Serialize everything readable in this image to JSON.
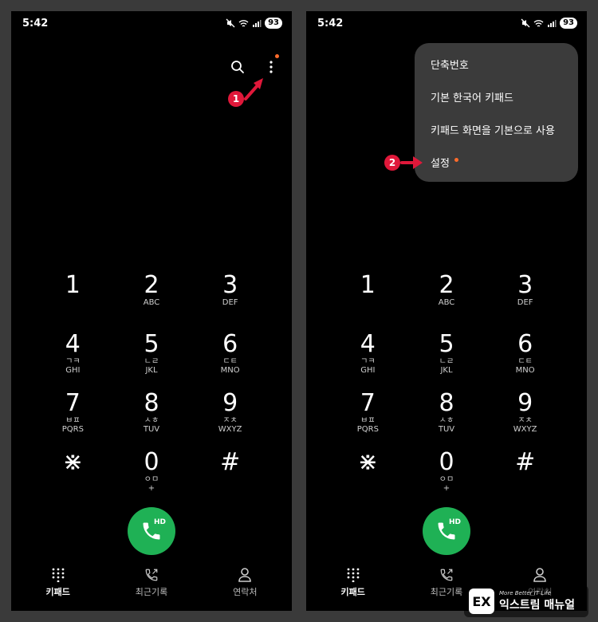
{
  "status": {
    "time": "5:42",
    "battery": "93"
  },
  "keypad": [
    {
      "digit": "1",
      "korean": "",
      "latin": ""
    },
    {
      "digit": "2",
      "korean": "",
      "latin": "ABC"
    },
    {
      "digit": "3",
      "korean": "",
      "latin": "DEF"
    },
    {
      "digit": "4",
      "korean": "ㄱㅋ",
      "latin": "GHI"
    },
    {
      "digit": "5",
      "korean": "ㄴㄹ",
      "latin": "JKL"
    },
    {
      "digit": "6",
      "korean": "ㄷㅌ",
      "latin": "MNO"
    },
    {
      "digit": "7",
      "korean": "ㅂㅍ",
      "latin": "PQRS"
    },
    {
      "digit": "8",
      "korean": "ㅅㅎ",
      "latin": "TUV"
    },
    {
      "digit": "9",
      "korean": "ㅈㅊ",
      "latin": "WXYZ"
    },
    {
      "digit": "⋇",
      "korean": "",
      "latin": ""
    },
    {
      "digit": "0",
      "korean": "ㅇㅁ",
      "latin": "+"
    },
    {
      "digit": "#",
      "korean": "",
      "latin": ""
    }
  ],
  "call": {
    "hd_label": "HD"
  },
  "nav": {
    "keypad": "키패드",
    "recents": "최근기록",
    "contacts": "연락처"
  },
  "menu": {
    "items": [
      "단축번호",
      "기본 한국어 키패드",
      "키패드 화면을 기본으로 사용",
      "설정"
    ]
  },
  "annotations": {
    "step1": "1",
    "step2": "2"
  },
  "watermark": {
    "tagline": "More Better IT Life",
    "brand": "익스트림 매뉴얼",
    "logo": "EX"
  },
  "colors": {
    "call_green": "#1fb155",
    "badge_red": "#e0183a",
    "notify_orange": "#ff6b2b",
    "menu_bg": "#3b3b3b"
  }
}
